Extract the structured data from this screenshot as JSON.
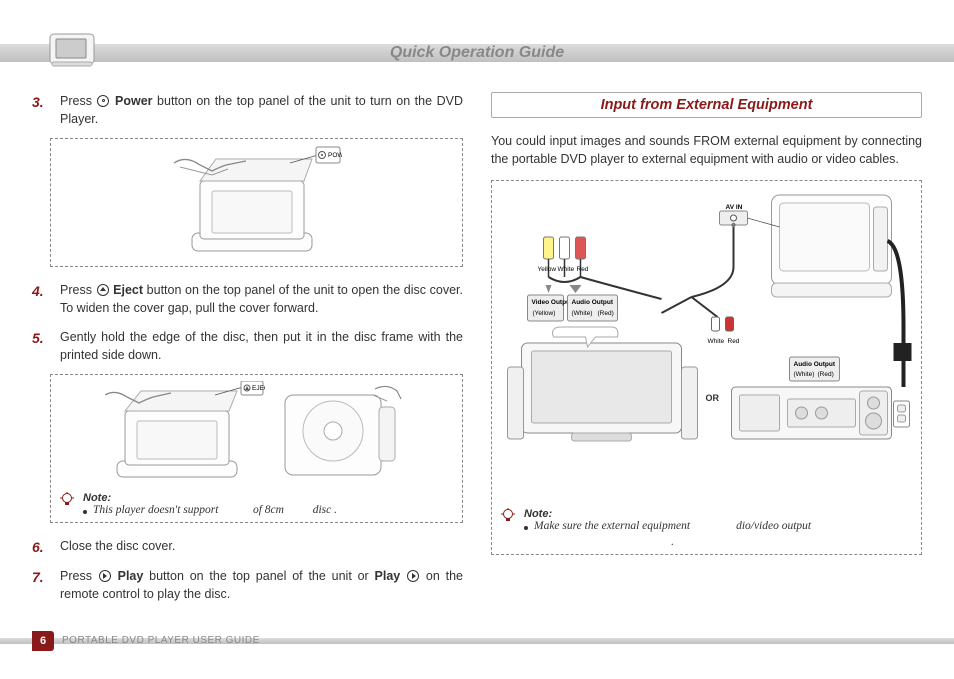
{
  "page_title": "Quick Operation Guide",
  "left": {
    "steps": {
      "s3": {
        "num": "3.",
        "pre": "Press ",
        "btn": "Power",
        "post": " button on the top panel of the unit to turn on the DVD Player."
      },
      "s4": {
        "num": "4.",
        "pre": "Press ",
        "btn": "Eject",
        "post": " button on the top panel of the unit to open the disc cover. To widen the cover gap, pull the cover forward."
      },
      "s5": {
        "num": "5.",
        "text": "Gently hold the edge of the disc, then put it in the disc frame with the printed side down."
      },
      "s6": {
        "num": "6.",
        "text": "Close the disc cover."
      },
      "s7": {
        "num": "7.",
        "pre": "Press ",
        "btn": "Play",
        "mid": " button on the top panel of the unit or ",
        "btn2": "Play",
        "post": " on the remote control to play the disc."
      }
    },
    "fig1": {
      "power_label": "POWER"
    },
    "fig2": {
      "eject_label": "EJECT"
    },
    "note": {
      "label": "Note:",
      "text_a": "This player doesn't support ",
      "text_b": "of 8cm ",
      "text_c": "disc ."
    }
  },
  "right": {
    "title": "Input from External Equipment",
    "para": "You could input images and sounds FROM external equipment by connecting the portable DVD player to external equipment with audio or video cables.",
    "diagram": {
      "av_in": "AV IN",
      "cable_colors": {
        "yellow": "Yellow",
        "white": "White",
        "red": "Red"
      },
      "video_output": {
        "title": "Video Output",
        "yellow": "(Yellow)"
      },
      "audio_output": {
        "title": "Audio Output",
        "white": "(White)",
        "red": "(Red)"
      },
      "plug_white": "White",
      "plug_red": "Red",
      "or": "OR",
      "audio_output2": {
        "title": "Audio Output",
        "white": "(White)",
        "red": "(Red)"
      }
    },
    "note": {
      "label": "Note:",
      "text_a": "Make sure the external equipment ",
      "text_b": "dio/video output",
      "text_c": "."
    }
  },
  "footer": {
    "page_num": "6",
    "title": "PORTABLE DVD PLAYER USER GUIDE"
  }
}
